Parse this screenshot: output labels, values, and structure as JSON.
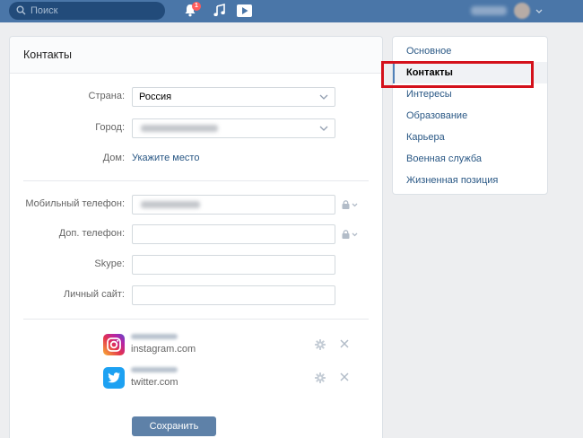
{
  "header": {
    "search_placeholder": "Поиск",
    "notification_count": "1",
    "user_name": "Михаил"
  },
  "card": {
    "title": "Контакты",
    "country": {
      "label": "Страна:",
      "value": "Россия"
    },
    "city": {
      "label": "Город:",
      "value": "Санкт-Петербург"
    },
    "home": {
      "label": "Дом:",
      "link": "Укажите место"
    },
    "mobile": {
      "label": "Мобильный телефон:",
      "value": "+79001234567"
    },
    "extra_phone": {
      "label": "Доп. телефон:",
      "value": ""
    },
    "skype": {
      "label": "Skype:",
      "value": ""
    },
    "site": {
      "label": "Личный сайт:",
      "value": ""
    },
    "services": [
      {
        "user": "username",
        "name": "instagram.com"
      },
      {
        "user": "username",
        "name": "twitter.com"
      }
    ],
    "save_label": "Сохранить"
  },
  "menu": {
    "items": [
      {
        "label": "Основное"
      },
      {
        "label": "Контакты"
      },
      {
        "label": "Интересы"
      },
      {
        "label": "Образование"
      },
      {
        "label": "Карьера"
      },
      {
        "label": "Военная служба"
      },
      {
        "label": "Жизненная позиция"
      }
    ],
    "active_index": 1
  },
  "colors": {
    "header_bg": "#4a76a8",
    "link": "#2a5885",
    "button": "#5e81a8",
    "highlight": "#d4111b"
  }
}
